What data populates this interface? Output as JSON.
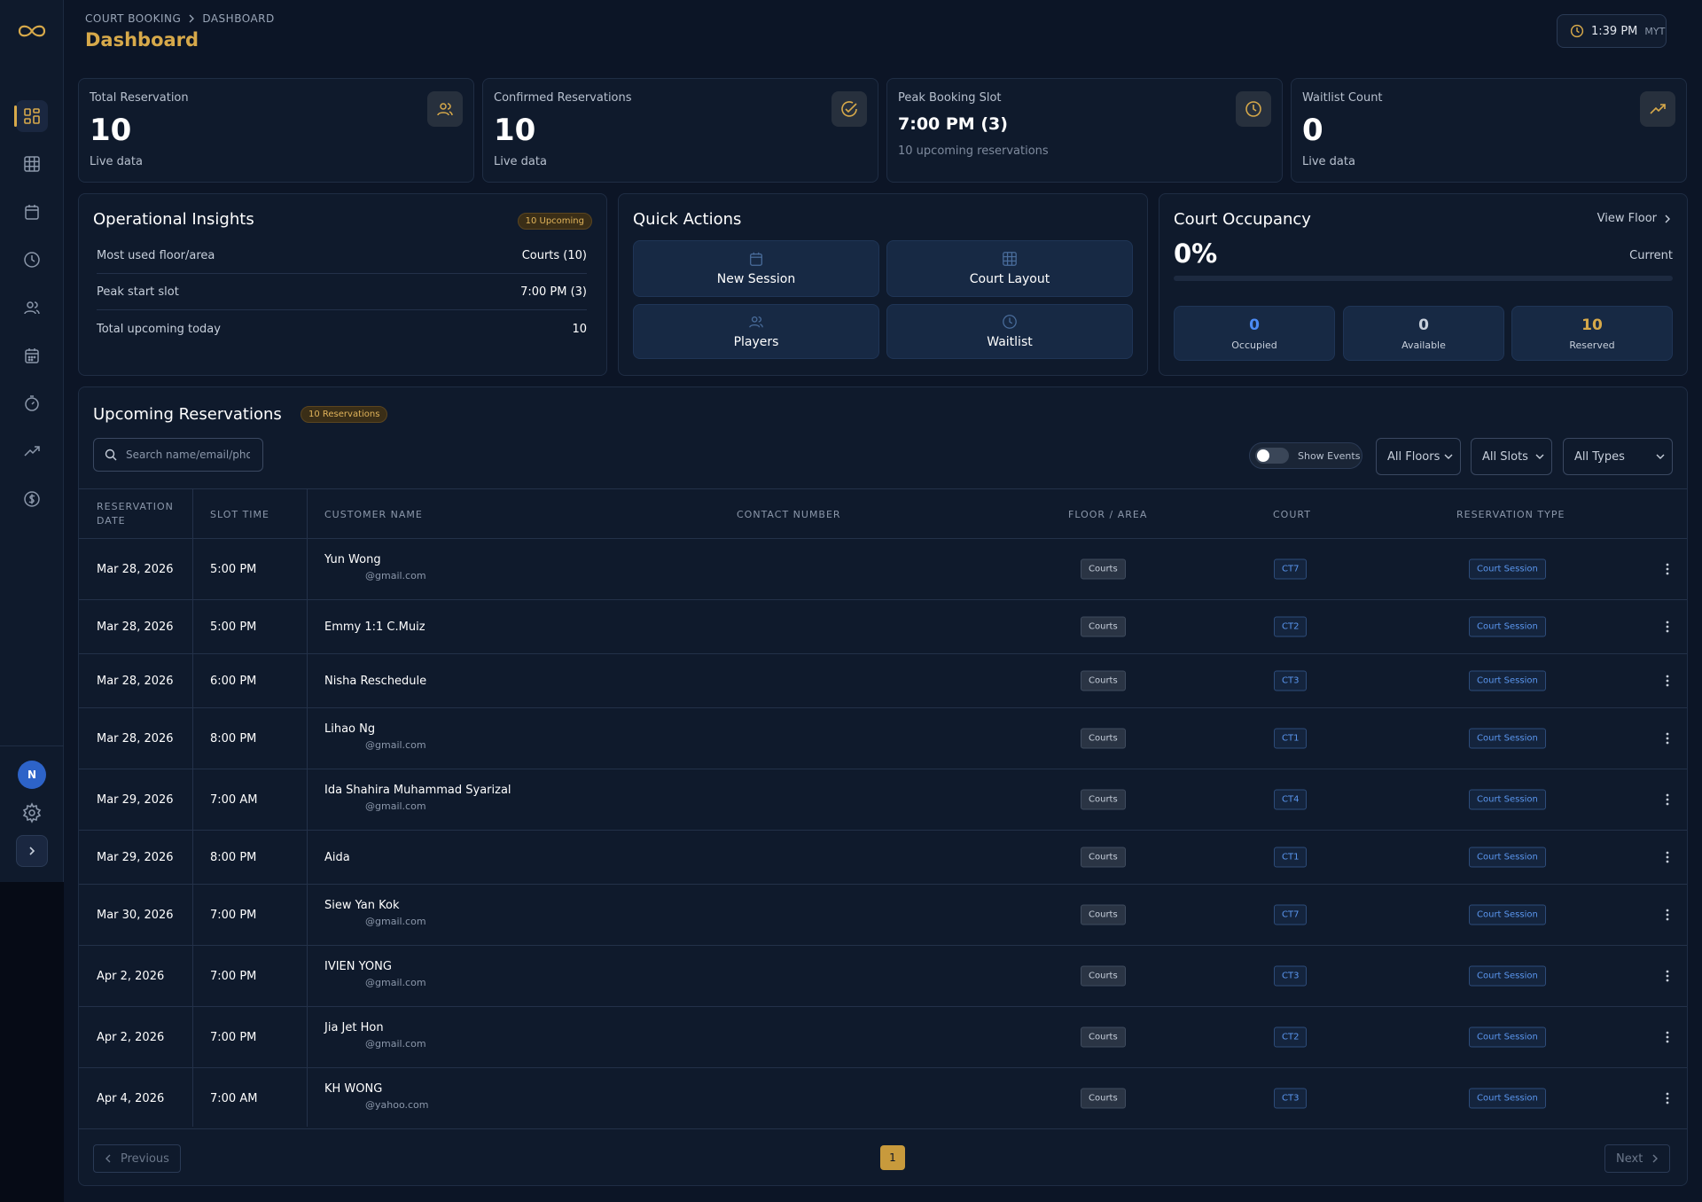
{
  "header": {
    "breadcrumb": [
      "COURT BOOKING",
      "DASHBOARD"
    ],
    "title": "Dashboard",
    "time": "1:39 PM",
    "timezone": "MYT"
  },
  "sidebar": {
    "items": [
      "dashboard",
      "courts-grid",
      "calendar",
      "history",
      "players",
      "schedule",
      "timer",
      "analytics",
      "billing"
    ],
    "avatar_initial": "N"
  },
  "stats": [
    {
      "label": "Total Reservation",
      "value": "10",
      "sub": "Live data",
      "icon": "users-icon"
    },
    {
      "label": "Confirmed Reservations",
      "value": "10",
      "sub": "Live data",
      "icon": "check-circle-icon"
    },
    {
      "label": "Peak Booking Slot",
      "value": "7:00 PM (3)",
      "sub": "10 upcoming reservations",
      "icon": "clock-icon"
    },
    {
      "label": "Waitlist Count",
      "value": "0",
      "sub": "Live data",
      "icon": "trend-up-icon"
    }
  ],
  "insights": {
    "title": "Operational Insights",
    "badge": "10 Upcoming",
    "rows": [
      {
        "label": "Most used floor/area",
        "value": "Courts (10)"
      },
      {
        "label": "Peak start slot",
        "value": "7:00 PM (3)"
      },
      {
        "label": "Total upcoming today",
        "value": "10"
      }
    ]
  },
  "quick_actions": {
    "title": "Quick Actions",
    "buttons": [
      "New Session",
      "Court Layout",
      "Players",
      "Waitlist"
    ]
  },
  "occupancy": {
    "title": "Court Occupancy",
    "view_floor": "View Floor",
    "percent": "0%",
    "percent_value": 0,
    "current_label": "Current",
    "boxes": [
      {
        "value": "0",
        "label": "Occupied",
        "color": "#4c8bf5"
      },
      {
        "value": "0",
        "label": "Available",
        "color": "#c7cfdb"
      },
      {
        "value": "10",
        "label": "Reserved",
        "color": "#d7a94a"
      }
    ]
  },
  "reservations": {
    "title": "Upcoming Reservations",
    "badge": "10 Reservations",
    "search_placeholder": "Search name/email/phone",
    "toggle_label": "Show Events",
    "filters": [
      "All Floors",
      "All Slots",
      "All Types"
    ],
    "columns": [
      "RESERVATION DATE",
      "SLOT TIME",
      "CUSTOMER NAME",
      "CONTACT NUMBER",
      "FLOOR / AREA",
      "COURT",
      "RESERVATION TYPE"
    ],
    "rows": [
      {
        "date": "Mar 28, 2026",
        "time": "5:00 PM",
        "name": "Yun Wong",
        "email": "@gmail.com",
        "floor": "Courts",
        "court": "CT7",
        "type": "Court Session"
      },
      {
        "date": "Mar 28, 2026",
        "time": "5:00 PM",
        "name": "Emmy 1:1 C.Muiz",
        "email": "",
        "floor": "Courts",
        "court": "CT2",
        "type": "Court Session"
      },
      {
        "date": "Mar 28, 2026",
        "time": "6:00 PM",
        "name": "Nisha Reschedule",
        "email": "",
        "floor": "Courts",
        "court": "CT3",
        "type": "Court Session"
      },
      {
        "date": "Mar 28, 2026",
        "time": "8:00 PM",
        "name": "Lihao Ng",
        "email": "@gmail.com",
        "floor": "Courts",
        "court": "CT1",
        "type": "Court Session"
      },
      {
        "date": "Mar 29, 2026",
        "time": "7:00 AM",
        "name": "Ida Shahira Muhammad Syarizal",
        "email": "@gmail.com",
        "floor": "Courts",
        "court": "CT4",
        "type": "Court Session"
      },
      {
        "date": "Mar 29, 2026",
        "time": "8:00 PM",
        "name": "Aida",
        "email": "",
        "floor": "Courts",
        "court": "CT1",
        "type": "Court Session"
      },
      {
        "date": "Mar 30, 2026",
        "time": "7:00 PM",
        "name": "Siew Yan Kok",
        "email": "@gmail.com",
        "floor": "Courts",
        "court": "CT7",
        "type": "Court Session"
      },
      {
        "date": "Apr 2, 2026",
        "time": "7:00 PM",
        "name": "IVIEN YONG",
        "email": "@gmail.com",
        "floor": "Courts",
        "court": "CT3",
        "type": "Court Session"
      },
      {
        "date": "Apr 2, 2026",
        "time": "7:00 PM",
        "name": "Jia Jet Hon",
        "email": "@gmail.com",
        "floor": "Courts",
        "court": "CT2",
        "type": "Court Session"
      },
      {
        "date": "Apr 4, 2026",
        "time": "7:00 AM",
        "name": "KH WONG",
        "email": "@yahoo.com",
        "floor": "Courts",
        "court": "CT3",
        "type": "Court Session"
      }
    ],
    "pagination": {
      "previous": "Previous",
      "page": "1",
      "next": "Next"
    }
  },
  "colors": {
    "accent": "#d7a94a",
    "blue": "#4c8bf5",
    "background": "#0c1526"
  }
}
